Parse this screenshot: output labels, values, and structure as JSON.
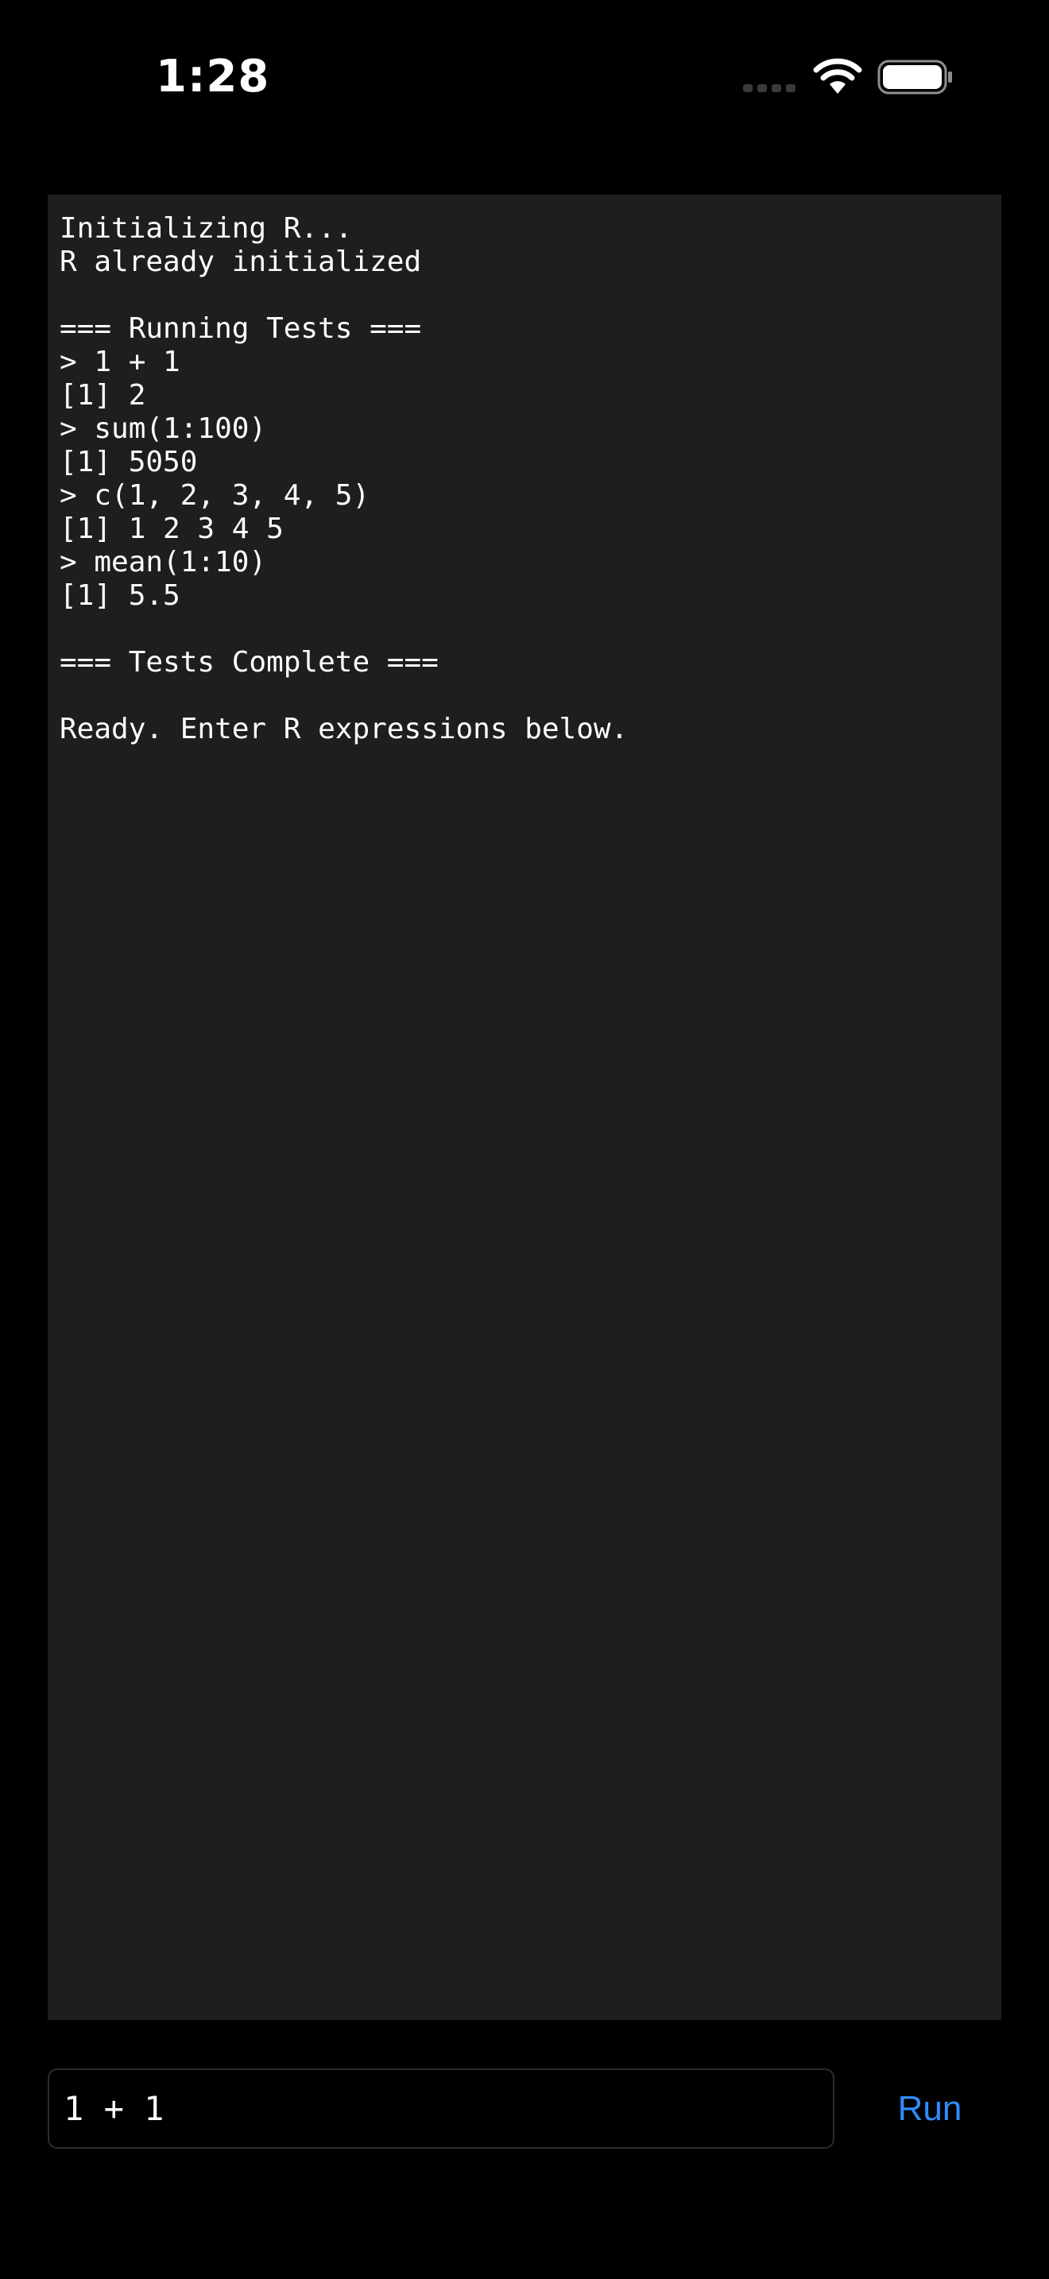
{
  "status_bar": {
    "time": "1:28"
  },
  "console": {
    "lines": [
      "Initializing R...",
      "R already initialized",
      "",
      "=== Running Tests ===",
      "> 1 + 1",
      "[1] 2",
      "> sum(1:100)",
      "[1] 5050",
      "> c(1, 2, 3, 4, 5)",
      "[1] 1 2 3 4 5",
      "> mean(1:10)",
      "[1] 5.5",
      "",
      "=== Tests Complete ===",
      "",
      "Ready. Enter R expressions below."
    ]
  },
  "input": {
    "value": "1 + 1"
  },
  "run_button": {
    "label": "Run",
    "color": "#2f8cff"
  },
  "icons": {
    "signal": "cellular-signal-icon",
    "wifi": "wifi-icon",
    "battery": "battery-icon"
  }
}
